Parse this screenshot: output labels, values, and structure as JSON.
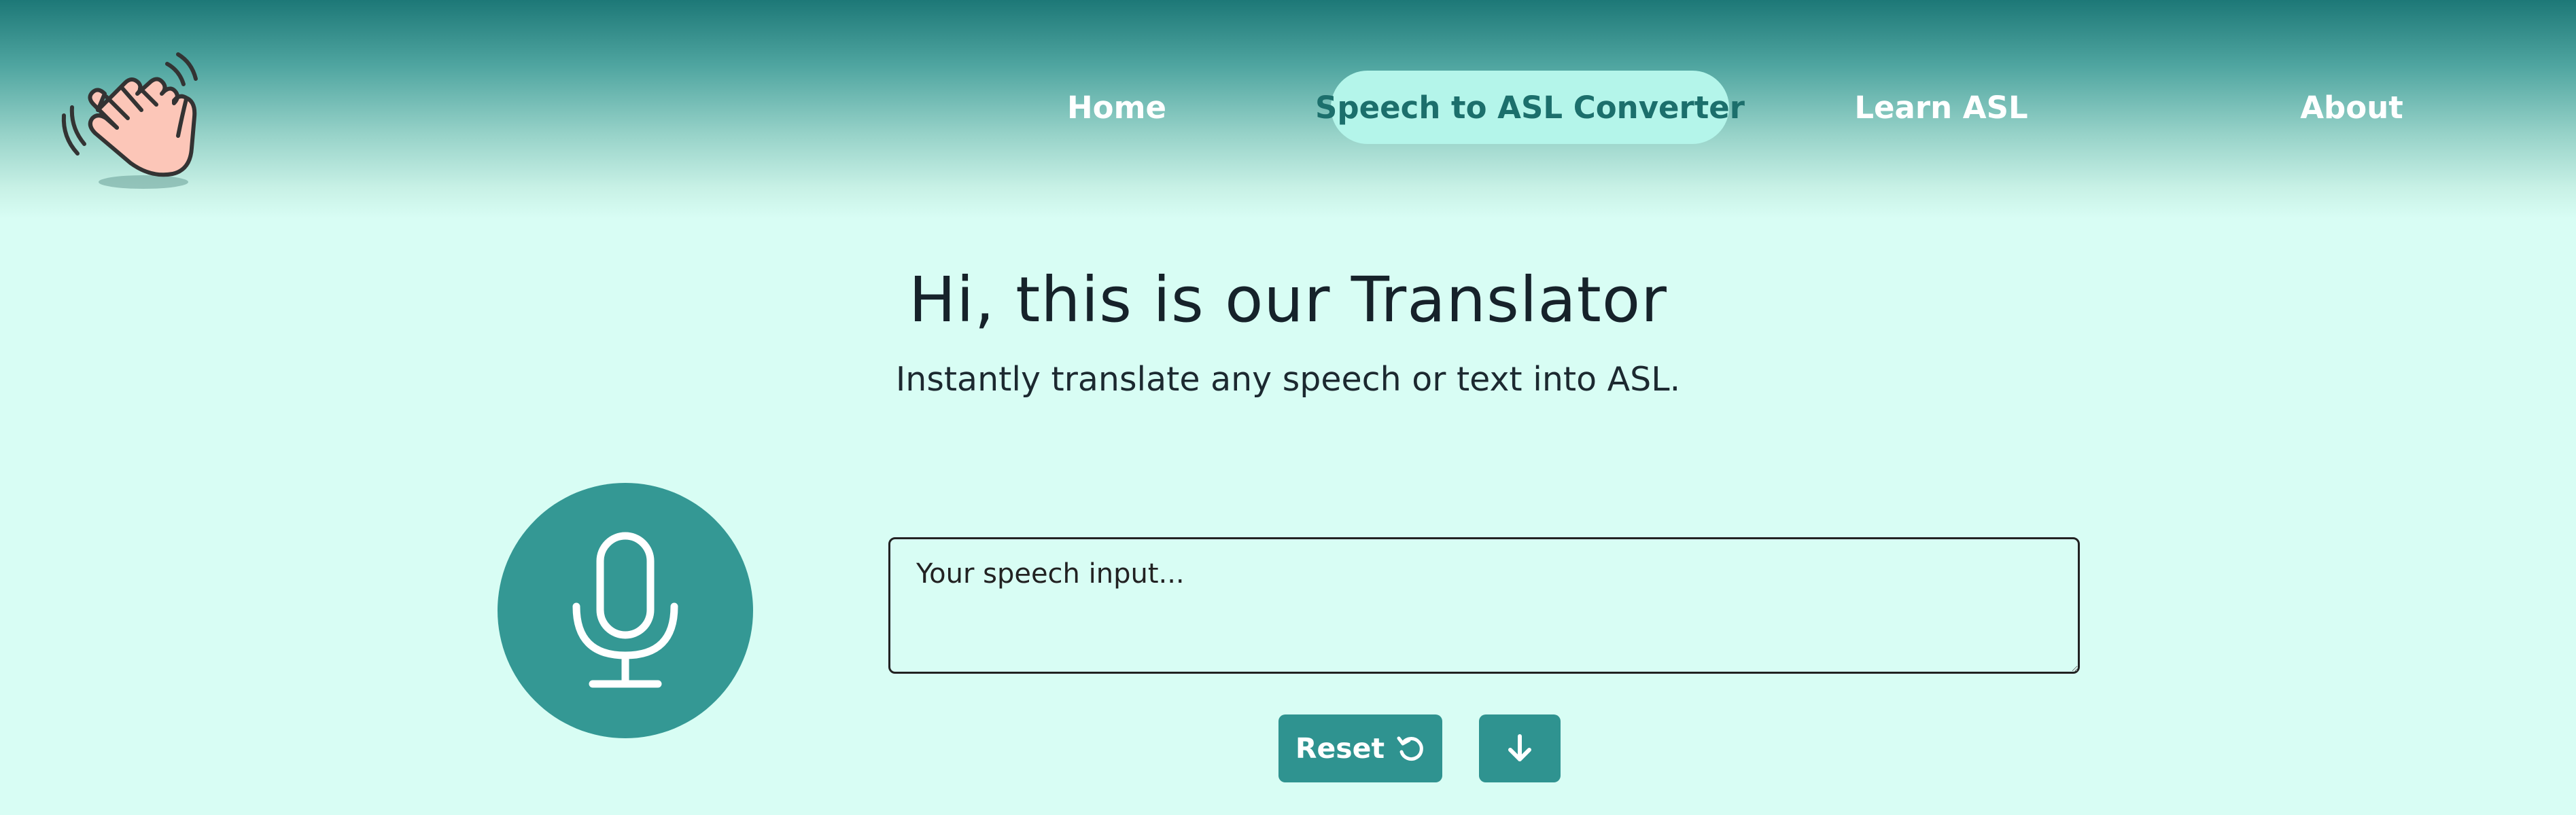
{
  "nav": {
    "items": [
      {
        "label": "Home",
        "active": false
      },
      {
        "label": "Speech to ASL Converter",
        "active": true
      },
      {
        "label": "Learn ASL",
        "active": false
      },
      {
        "label": "About",
        "active": false
      }
    ]
  },
  "logo": {
    "icon": "waving-hand-icon"
  },
  "hero": {
    "title": "Hi, this is our Translator",
    "subtitle": "Instantly translate any speech or text into ASL."
  },
  "speech": {
    "mic_icon": "microphone-icon",
    "input_placeholder": "Your speech input...",
    "input_value": ""
  },
  "actions": {
    "reset_label": "Reset",
    "reset_icon": "rotate-ccw-icon",
    "download_icon": "arrow-down-icon"
  },
  "colors": {
    "background": "#d8fdf4",
    "header_dark": "#1d7877",
    "accent": "#349894",
    "active_nav_bg": "#b4f5ea",
    "active_nav_text": "#1c6f6c"
  }
}
